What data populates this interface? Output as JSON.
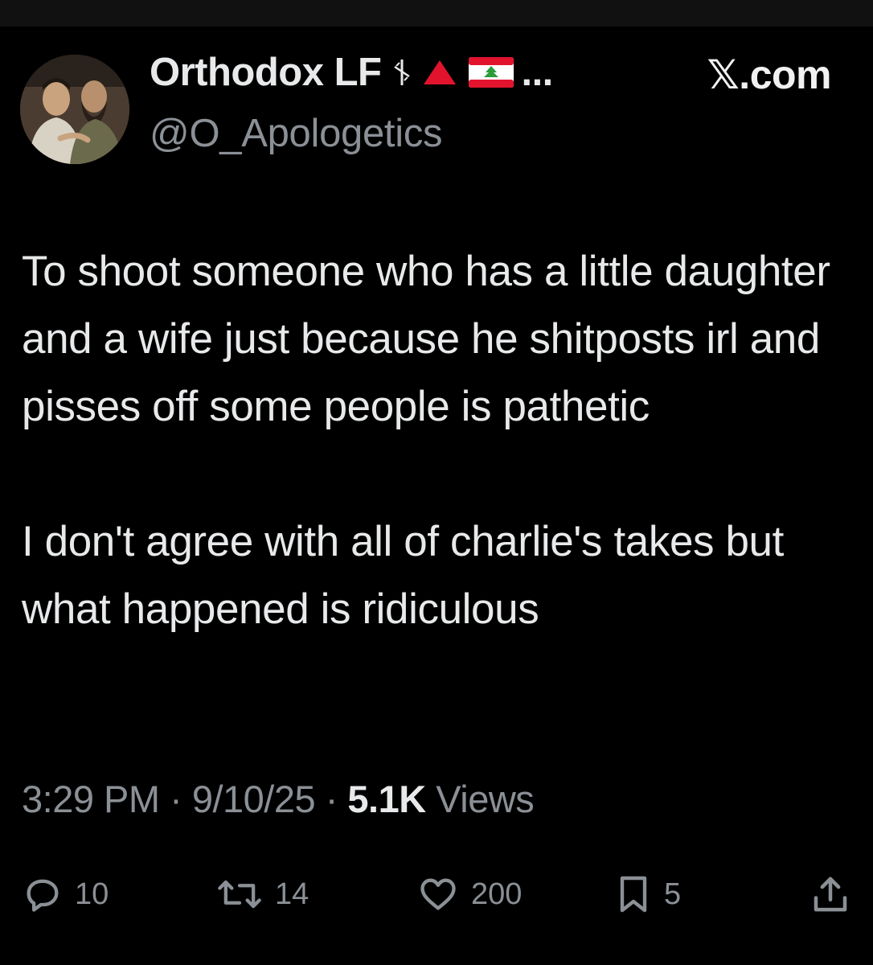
{
  "header": {
    "display_name": "Orthodox LF",
    "ellipsis": "...",
    "handle": "@O_Apologetics",
    "brand": "𝕏.com",
    "icons": [
      "lf-cross-icon",
      "red-triangle-icon",
      "lebanon-flag-icon"
    ]
  },
  "tweet": {
    "paragraphs": [
      "To shoot someone who has a little daughter and a wife just because he shitposts irl and pisses off some people is pathetic",
      "I don't agree with all of charlie's takes but what happened is ridiculous"
    ]
  },
  "meta": {
    "time": "3:29 PM",
    "separator": "·",
    "date": "9/10/25",
    "views_count": "5.1K",
    "views_label": "Views"
  },
  "actions": {
    "replies": "10",
    "reposts": "14",
    "likes": "200",
    "bookmarks": "5"
  },
  "colors": {
    "background": "#000000",
    "text": "#e7e9ea",
    "secondary": "#8b9096",
    "triangle": "#e2142d",
    "flag_red": "#e2142d",
    "flag_green": "#2a9d3a"
  }
}
